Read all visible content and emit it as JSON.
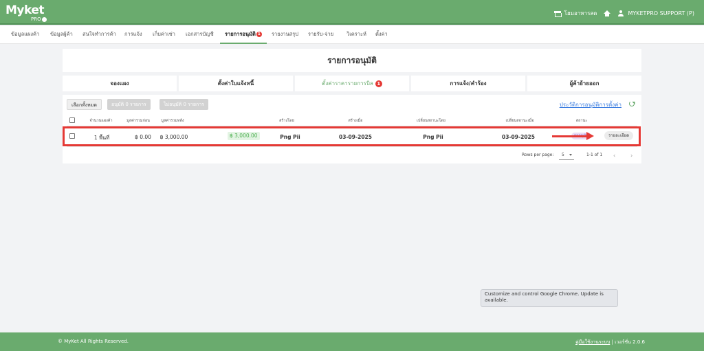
{
  "app": {
    "logo_text": "Myket",
    "logo_sub": "PRO",
    "store_label": "โฮมอาหารสด",
    "user_label": "MYKETPRO SUPPORT (P)"
  },
  "nav": {
    "items": [
      {
        "label": "ข้อมูลแผงค้า"
      },
      {
        "label": "ข้อมูลผู้ค้า"
      },
      {
        "label": "สนใจทำการค้า"
      },
      {
        "label": "การแจ้ง"
      },
      {
        "label": "เก็บค่าเช่า"
      },
      {
        "label": "เอกสารบัญชี"
      },
      {
        "label": "รายการอนุมัติ",
        "badge": "1",
        "active": true
      },
      {
        "label": "รายงานสรุป"
      },
      {
        "label": "รายรับ-จ่าย"
      },
      {
        "label": "วิเคราะห์"
      },
      {
        "label": "ตั้งค่า"
      }
    ]
  },
  "page": {
    "title": "รายการอนุมัติ"
  },
  "tabs": [
    {
      "label": "จองแผง"
    },
    {
      "label": "ตั้งค่าใบแจ้งหนี้"
    },
    {
      "label": "ตั้งค่าราคารายการบิล",
      "badge": "1",
      "active": true
    },
    {
      "label": "การแจ้ง/คำร้อง"
    },
    {
      "label": "ผู้ค้าย้ายออก"
    }
  ],
  "toolbar": {
    "select_all": "เลือกทั้งหมด",
    "approve": "อนุมัติ 0 รายการ",
    "reject": "ไม่อนุมัติ 0 รายการ",
    "history_link": "ประวัติการอนุมัติการตั้งค่า"
  },
  "table": {
    "headers": [
      "จำนวนแผงค้า",
      "มูลค่ารวมก่อน",
      "มูลค่ารวมหลัง",
      "สร้างโดย",
      "สร้างเมื่อ",
      "เปลี่ยนสถานะโดย",
      "เปลี่ยนสถานะเมื่อ",
      "สถานะ"
    ],
    "rows": [
      {
        "stalls": "1 พื้นที่",
        "before": "฿ 0.00",
        "after": "฿ 3,000.00",
        "change": "฿ 3,000.00",
        "created_by": "Png Pii",
        "created_at": "03-09-2025",
        "status_by": "Png Pii",
        "status_at": "03-09-2025",
        "status": "รออนุมัติ",
        "detail": "รายละเอียด"
      }
    ]
  },
  "pagination": {
    "rows_label": "Rows per page:",
    "rows_value": "5",
    "range": "1-1 of 1"
  },
  "tooltip": "Customize and control Google Chrome. Update is available.",
  "footer": {
    "copyright": "© MyKet All Rights Reserved.",
    "manual": "คู่มือใช้งานระบบ",
    "version": "| เวอร์ชั่น 2.0.6"
  },
  "colors": {
    "brand": "#6aab6e",
    "alert": "#e53935",
    "link": "#3b7de0"
  }
}
